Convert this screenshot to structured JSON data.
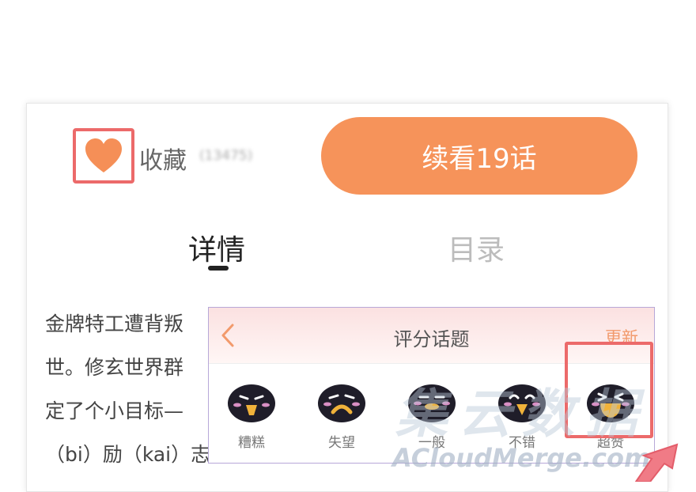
{
  "favorite": {
    "label": "收藏",
    "count": "(13475)"
  },
  "continue_button": {
    "label": "续看19话"
  },
  "tabs": [
    {
      "label": "详情",
      "active": true
    },
    {
      "label": "目录",
      "active": false
    }
  ],
  "description": [
    "金牌特工遭背叛",
    "世。修玄世界群",
    "定了个小目标—",
    "（bi）励（kai）志"
  ],
  "rating_popup": {
    "title": "评分话题",
    "update_label": "更新",
    "options": [
      {
        "label": "糟糕",
        "mood": "bad"
      },
      {
        "label": "失望",
        "mood": "disappointed"
      },
      {
        "label": "一般",
        "mood": "neutral"
      },
      {
        "label": "不错",
        "mood": "good"
      },
      {
        "label": "超赞",
        "mood": "great",
        "highlighted": true
      }
    ]
  },
  "watermark": {
    "cn": "集云数据",
    "en": "ACloudMerge.com"
  },
  "colors": {
    "accent": "#f6935a",
    "heart": "#f58f57",
    "highlight_frame": "#ec6a6a",
    "update_link": "#f29a6c"
  }
}
